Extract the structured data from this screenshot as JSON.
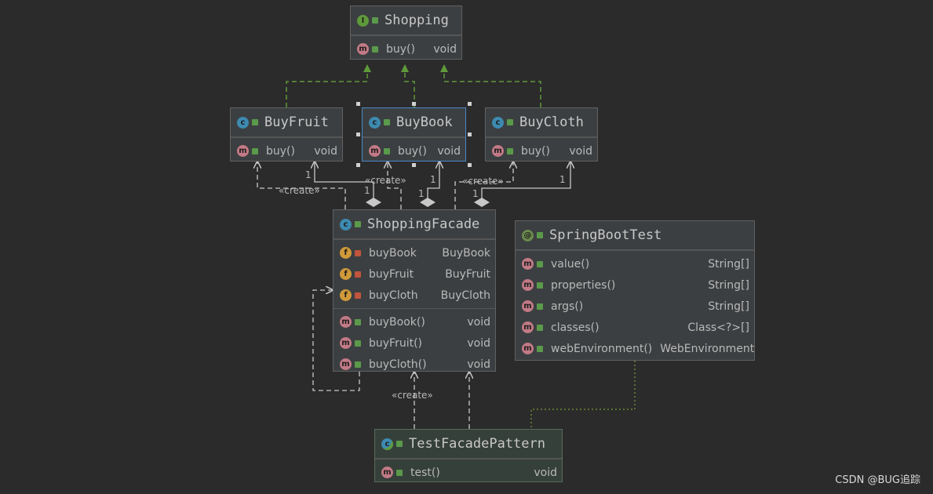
{
  "classes": {
    "shopping": {
      "name": "Shopping",
      "kind_icon": "interface-icon",
      "methods": [
        {
          "name": "buy()",
          "type": "void"
        }
      ]
    },
    "buyfruit": {
      "name": "BuyFruit",
      "kind_icon": "class-icon",
      "methods": [
        {
          "name": "buy()",
          "type": "void"
        }
      ]
    },
    "buybook": {
      "name": "BuyBook",
      "kind_icon": "class-icon",
      "methods": [
        {
          "name": "buy()",
          "type": "void"
        }
      ]
    },
    "buycloth": {
      "name": "BuyCloth",
      "kind_icon": "class-icon",
      "methods": [
        {
          "name": "buy()",
          "type": "void"
        }
      ]
    },
    "facade": {
      "name": "ShoppingFacade",
      "kind_icon": "class-icon",
      "fields": [
        {
          "name": "buyBook",
          "type": "BuyBook"
        },
        {
          "name": "buyFruit",
          "type": "BuyFruit"
        },
        {
          "name": "buyCloth",
          "type": "BuyCloth"
        }
      ],
      "methods": [
        {
          "name": "buyBook()",
          "type": "void"
        },
        {
          "name": "buyFruit()",
          "type": "void"
        },
        {
          "name": "buyCloth()",
          "type": "void"
        }
      ]
    },
    "springboottest": {
      "name": "SpringBootTest",
      "kind_icon": "annotation-icon",
      "methods": [
        {
          "name": "value()",
          "type": "String[]"
        },
        {
          "name": "properties()",
          "type": "String[]"
        },
        {
          "name": "args()",
          "type": "String[]"
        },
        {
          "name": "classes()",
          "type": "Class<?>[]"
        },
        {
          "name": "webEnvironment()",
          "type": "WebEnvironment"
        }
      ]
    },
    "testfacade": {
      "name": "TestFacadePattern",
      "kind_icon": "test-class-icon",
      "methods": [
        {
          "name": "test()",
          "type": "void"
        }
      ]
    }
  },
  "edge_labels": {
    "create": "«create»",
    "one": "1"
  },
  "watermark": "CSDN @BUG追踪",
  "colors": {
    "background": "#2b2b2b",
    "implements": "#5f9a3a",
    "association": "#c8c8c8",
    "annotation_link": "#7a9a3a",
    "selection": "#4a88c7"
  }
}
